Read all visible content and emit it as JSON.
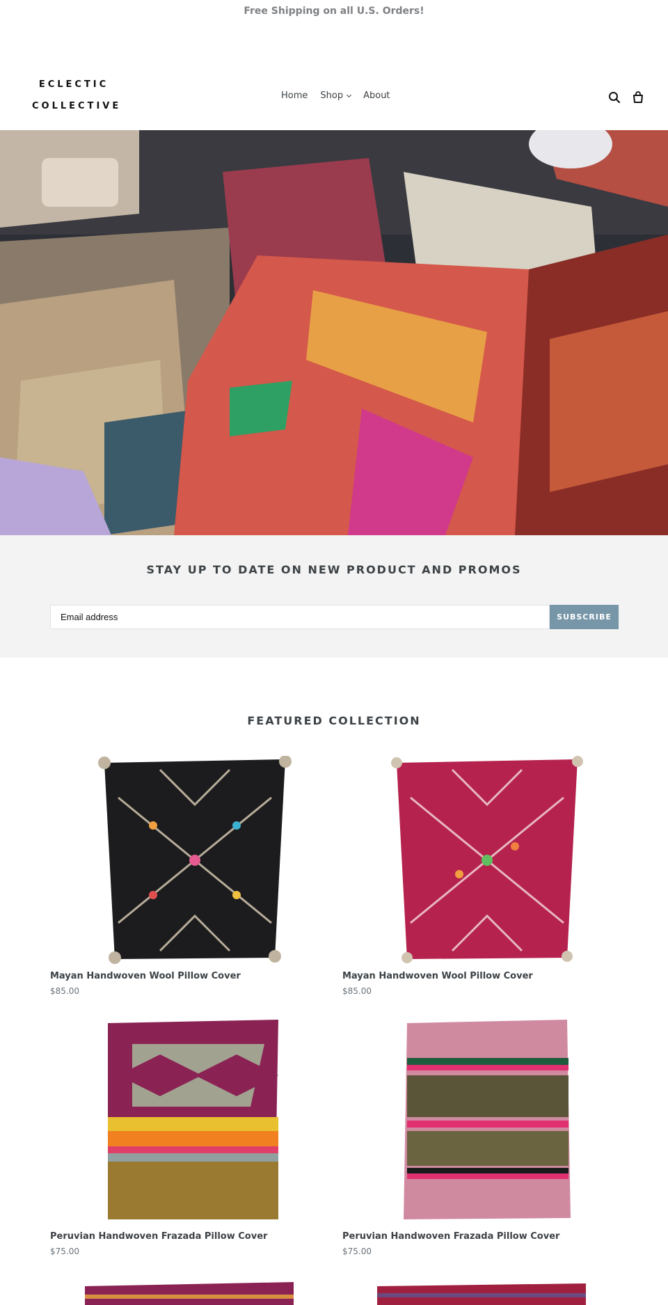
{
  "announcement": "Free Shipping on all U.S. Orders!",
  "logo": {
    "line1": "ECLECTIC",
    "line2": "COLLECTIVE"
  },
  "nav": {
    "home": "Home",
    "shop": "Shop",
    "about": "About"
  },
  "icons": {
    "search": "search-icon",
    "cart": "cart-icon"
  },
  "newsletter": {
    "title": "STAY UP TO DATE ON NEW PRODUCT AND PROMOS",
    "placeholder": "Email address",
    "button": "SUBSCRIBE"
  },
  "featured": {
    "title": "FEATURED COLLECTION",
    "products": [
      {
        "title": "Mayan Handwoven Wool Pillow Cover",
        "price": "$85.00"
      },
      {
        "title": "Mayan Handwoven Wool Pillow Cover",
        "price": "$85.00"
      },
      {
        "title": "Peruvian Handwoven Frazada Pillow Cover",
        "price": "$75.00"
      },
      {
        "title": "Peruvian Handwoven Frazada Pillow Cover",
        "price": "$75.00"
      }
    ]
  },
  "colors": {
    "accent": "#7796a8",
    "text": "#3d4246",
    "newsletter_bg": "#f2f3f2"
  }
}
